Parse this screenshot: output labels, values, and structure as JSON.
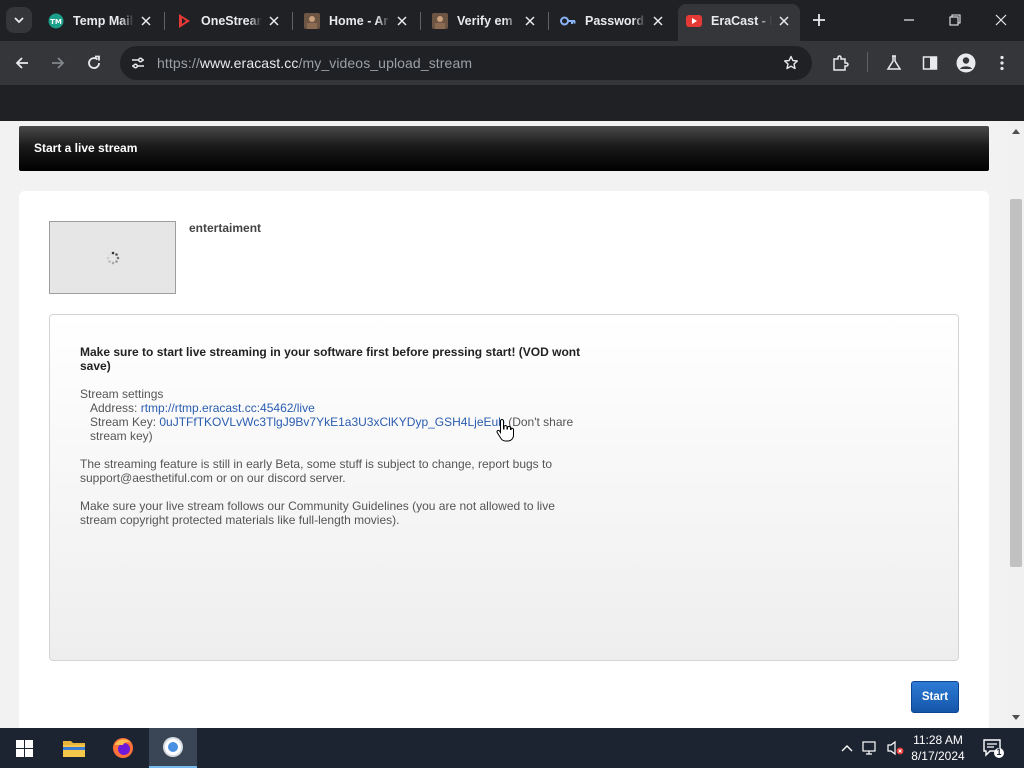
{
  "browser": {
    "tabs": [
      {
        "label": "Temp Mail",
        "icon": "tempmail-favicon"
      },
      {
        "label": "OneStream",
        "icon": "onestream-favicon"
      },
      {
        "label": "Home - Ar",
        "icon": "avatar-favicon"
      },
      {
        "label": "Verify em",
        "icon": "avatar-favicon"
      },
      {
        "label": "Password",
        "icon": "key-favicon"
      },
      {
        "label": "EraCast - L",
        "icon": "youtube-favicon",
        "active": true
      }
    ],
    "url_prefix": "https://",
    "url_domain": "www.eracast.cc",
    "url_path": "/my_videos_upload_stream"
  },
  "page": {
    "panel_title": "Start a live stream",
    "stream_title": "entertaiment",
    "warning": "Make sure to start live streaming in your software first before pressing start! (VOD wont save)",
    "settings_heading": "Stream settings",
    "address_label": "Address:",
    "address_value": "rtmp://rtmp.eracast.cc:45462/live",
    "key_label": "Stream Key:",
    "key_value": "0uJTFfTKOVLvWc3TlgJ9Bv7YkE1a3U3xClKYDyp_GSH4LjeEub",
    "key_note": "(Don't share stream key)",
    "beta_note": "The streaming feature is still in early Beta, some stuff is subject to change, report bugs to support@aesthetiful.com or on our discord server.",
    "guidelines_note": "Make sure your live stream follows our Community Guidelines (you are not allowed to live stream copyright protected materials like full-length movies).",
    "start_label": "Start"
  },
  "taskbar": {
    "time": "11:28 AM",
    "date": "8/17/2024",
    "notification_count": "1"
  },
  "colors": {
    "chrome_dark": "#202124",
    "chrome_toolbar": "#35363a",
    "link": "#2a5db0",
    "start_button": "#1e6bc4",
    "taskbar": "#1c2431"
  }
}
